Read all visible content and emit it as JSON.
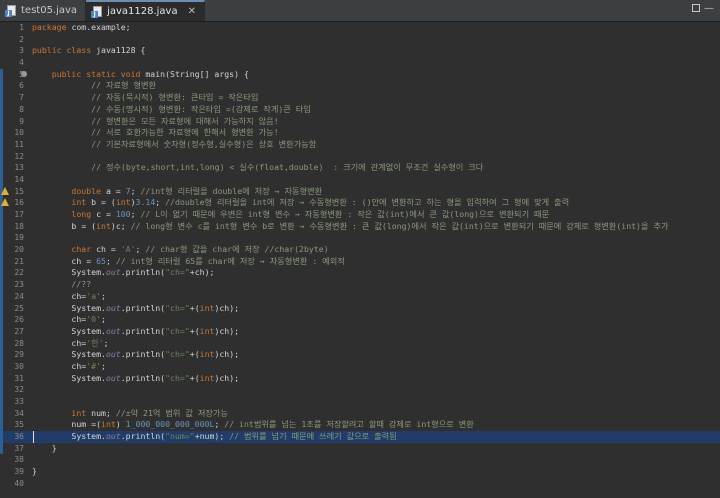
{
  "tabs": [
    {
      "label": "test05.java",
      "active": false
    },
    {
      "label": "java1128.java",
      "active": true
    }
  ],
  "lines": [
    {
      "n": "1",
      "segs": [
        [
          "kw",
          "package "
        ],
        [
          "plain",
          "com.example;"
        ]
      ]
    },
    {
      "n": "2",
      "segs": []
    },
    {
      "n": "3",
      "segs": [
        [
          "kw",
          "public class "
        ],
        [
          "plain",
          "java1128 {"
        ]
      ]
    },
    {
      "n": "4",
      "segs": []
    },
    {
      "n": "5",
      "marker": "bp",
      "segs": [
        [
          "kw",
          "    public static void "
        ],
        [
          "plain",
          "main(String[] args) {"
        ]
      ]
    },
    {
      "n": "6",
      "segs": [
        [
          "cm",
          "            // 자료형 형변환"
        ]
      ]
    },
    {
      "n": "7",
      "segs": [
        [
          "cm",
          "            // 자동(묵시적) 형변환: 큰타입 = 작은타입"
        ]
      ]
    },
    {
      "n": "8",
      "segs": [
        [
          "cm",
          "            // 수동(명시적) 형변환: 작은타입 =(강제로 작게)큰 타입"
        ]
      ]
    },
    {
      "n": "9",
      "segs": [
        [
          "cm",
          "            // 형변환은 모든 자료형에 대해서 가능하지 않음!"
        ]
      ]
    },
    {
      "n": "10",
      "segs": [
        [
          "cm",
          "            // 서로 호환가능한 자료형에 한해서 형변환 가능!"
        ]
      ]
    },
    {
      "n": "11",
      "segs": [
        [
          "cm",
          "            // 기본자료형에서 숫자형(정수형,실수형)은 상호 변환가능함"
        ]
      ]
    },
    {
      "n": "12",
      "segs": []
    },
    {
      "n": "13",
      "segs": [
        [
          "cm",
          "            // 정수(byte,short,int,long) < 실수(float,double)  : 크기에 관계없이 무조건 실수형이 크다"
        ]
      ]
    },
    {
      "n": "14",
      "segs": []
    },
    {
      "n": "15",
      "marker": "warn",
      "segs": [
        [
          "kw",
          "        double "
        ],
        [
          "plain",
          "a = "
        ],
        [
          "num",
          "7"
        ],
        [
          "plain",
          "; "
        ],
        [
          "cm",
          "//int형 리터럴을 double에 저장 → 자동형변환"
        ]
      ]
    },
    {
      "n": "16",
      "marker": "warn",
      "segs": [
        [
          "kw",
          "        int "
        ],
        [
          "plain",
          "b = ("
        ],
        [
          "kw",
          "int"
        ],
        [
          "plain",
          ")"
        ],
        [
          "num",
          "3.14"
        ],
        [
          "plain",
          "; "
        ],
        [
          "cm",
          "//double형 리터럴을 int에 저장 → 수동형변환 : ()안에 변환하고 하는 형을 입력하여 그 형에 맞게 출력"
        ]
      ]
    },
    {
      "n": "17",
      "segs": [
        [
          "kw",
          "        long "
        ],
        [
          "plain",
          "c = "
        ],
        [
          "num",
          "100"
        ],
        [
          "plain",
          "; "
        ],
        [
          "cm",
          "// L이 없기 때문에 우변은 int형 변수 → 자동형변환 : 작은 값(int)에서 큰 값(long)으로 변환되기 때문"
        ]
      ]
    },
    {
      "n": "18",
      "segs": [
        [
          "plain",
          "        b = ("
        ],
        [
          "kw",
          "int"
        ],
        [
          "plain",
          ")c; "
        ],
        [
          "cm",
          "// long형 변수 c를 int형 변수 b로 변환 → 수동형변환 : 큰 값(long)에서 작은 값(int)으로 변환되기 때문에 강제로 형변환(int)을 추가"
        ]
      ]
    },
    {
      "n": "19",
      "segs": []
    },
    {
      "n": "20",
      "segs": [
        [
          "kw",
          "        char "
        ],
        [
          "plain",
          "ch = "
        ],
        [
          "st",
          "'A'"
        ],
        [
          "plain",
          "; "
        ],
        [
          "cm",
          "// char형 값을 char에 저장 //char(2byte)"
        ]
      ]
    },
    {
      "n": "21",
      "segs": [
        [
          "plain",
          "        ch = "
        ],
        [
          "num",
          "65"
        ],
        [
          "plain",
          "; "
        ],
        [
          "cm",
          "// int형 리터럴 65를 char에 저장 → 자동형변환 : 예외적"
        ]
      ]
    },
    {
      "n": "22",
      "segs": [
        [
          "plain",
          "        System."
        ],
        [
          "sys",
          "out"
        ],
        [
          "plain",
          ".println("
        ],
        [
          "st",
          "\"ch=\""
        ],
        [
          "plain",
          "+ch);"
        ]
      ]
    },
    {
      "n": "23",
      "segs": [
        [
          "cm",
          "        //??"
        ]
      ]
    },
    {
      "n": "24",
      "segs": [
        [
          "plain",
          "        ch="
        ],
        [
          "st",
          "'a'"
        ],
        [
          "plain",
          ";"
        ]
      ]
    },
    {
      "n": "25",
      "segs": [
        [
          "plain",
          "        System."
        ],
        [
          "sys",
          "out"
        ],
        [
          "plain",
          ".println("
        ],
        [
          "st",
          "\"ch=\""
        ],
        [
          "plain",
          "+("
        ],
        [
          "kw",
          "int"
        ],
        [
          "plain",
          ")ch);"
        ]
      ]
    },
    {
      "n": "26",
      "segs": [
        [
          "plain",
          "        ch="
        ],
        [
          "st",
          "'0'"
        ],
        [
          "plain",
          ";"
        ]
      ]
    },
    {
      "n": "27",
      "segs": [
        [
          "plain",
          "        System."
        ],
        [
          "sys",
          "out"
        ],
        [
          "plain",
          ".println("
        ],
        [
          "st",
          "\"ch=\""
        ],
        [
          "plain",
          "+("
        ],
        [
          "kw",
          "int"
        ],
        [
          "plain",
          ")ch);"
        ]
      ]
    },
    {
      "n": "28",
      "segs": [
        [
          "plain",
          "        ch="
        ],
        [
          "st",
          "'한'"
        ],
        [
          "plain",
          ";"
        ]
      ]
    },
    {
      "n": "29",
      "segs": [
        [
          "plain",
          "        System."
        ],
        [
          "sys",
          "out"
        ],
        [
          "plain",
          ".println("
        ],
        [
          "st",
          "\"ch=\""
        ],
        [
          "plain",
          "+("
        ],
        [
          "kw",
          "int"
        ],
        [
          "plain",
          ")ch);"
        ]
      ]
    },
    {
      "n": "30",
      "segs": [
        [
          "plain",
          "        ch="
        ],
        [
          "st",
          "'#'"
        ],
        [
          "plain",
          ";"
        ]
      ]
    },
    {
      "n": "31",
      "segs": [
        [
          "plain",
          "        System."
        ],
        [
          "sys",
          "out"
        ],
        [
          "plain",
          ".println("
        ],
        [
          "st",
          "\"ch=\""
        ],
        [
          "plain",
          "+("
        ],
        [
          "kw",
          "int"
        ],
        [
          "plain",
          ")ch);"
        ]
      ]
    },
    {
      "n": "32",
      "segs": []
    },
    {
      "n": "33",
      "segs": []
    },
    {
      "n": "34",
      "segs": [
        [
          "kw",
          "        int "
        ],
        [
          "plain",
          "num; "
        ],
        [
          "cm",
          "//±약 21억 범위 값 저장가능"
        ]
      ]
    },
    {
      "n": "35",
      "segs": [
        [
          "plain",
          "        num =("
        ],
        [
          "kw",
          "int"
        ],
        [
          "plain",
          ") "
        ],
        [
          "num",
          "1_000_000_000_000L"
        ],
        [
          "plain",
          "; "
        ],
        [
          "cm",
          "// int범위를 넘는 1조를 저장할려고 할때 강제로 int형으로 변환"
        ]
      ]
    },
    {
      "n": "36",
      "current": true,
      "segs": [
        [
          "plain",
          "        System."
        ],
        [
          "sys",
          "out"
        ],
        [
          "plain",
          ".println("
        ],
        [
          "st",
          "\"num=\""
        ],
        [
          "plain",
          "+num); "
        ],
        [
          "cm",
          "// 범위를 넘기 때문에 쓰레기 값으로 출력됨"
        ]
      ]
    },
    {
      "n": "37",
      "segs": [
        [
          "plain",
          "    }"
        ]
      ]
    },
    {
      "n": "38",
      "segs": []
    },
    {
      "n": "39",
      "segs": [
        [
          "plain",
          "}"
        ]
      ]
    },
    {
      "n": "40",
      "segs": []
    }
  ]
}
